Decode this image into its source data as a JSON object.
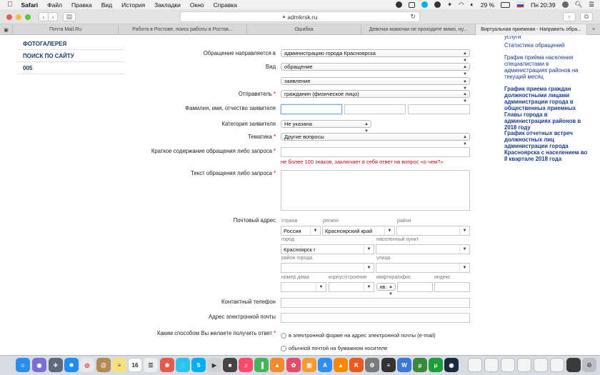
{
  "menubar": {
    "apple": "",
    "app": "Safari",
    "items": [
      "Файл",
      "Правка",
      "Вид",
      "История",
      "Закладки",
      "Окно",
      "Справка"
    ],
    "battery": "29 %",
    "clock": "Пн 20:39"
  },
  "toolbar": {
    "url": "admkrsk.ru",
    "back": "‹",
    "forward": "›"
  },
  "tabs": [
    "Почта Mail.Ru",
    "Работа в Ростове, поиск работы в Ростов...",
    "Ошибка",
    "Девочки мамочки не проходите мимо, ну...",
    "Виртуальная приемная - Направить обра..."
  ],
  "sidebar": {
    "items": [
      "ФОТОГАЛЕРЕЯ",
      "ПОИСК ПО САЙТУ",
      "005"
    ]
  },
  "form": {
    "direct_label": "Обращение направляется в",
    "direct_value": "администрацию города Красноярска",
    "type_label": "Вид",
    "type_value1": "обращение",
    "type_value2": "заявление",
    "sender_label": "Отправитель",
    "sender_value": "гражданин (физическое лицо)",
    "fio_label": "Фамилия, имя, отчество заявителя",
    "category_label": "Категория заявителя",
    "category_value": "Не указана",
    "topic_label": "Тематика",
    "topic_value": "Другие вопросы",
    "summary_label": "Краткое содержание обращения либо запроса",
    "summary_hint": "не более 100 знаков, заключает в себя ответ на вопрос «о чем?»",
    "text_label": "Текст обращения либо запроса",
    "postal_label": "Почтовый адрес",
    "country_label": "страна",
    "country_value": "Россия",
    "region_label": "регион",
    "region_value": "Красноярский край",
    "district_label": "район",
    "city_label": "город",
    "city_value": "Красноярск г",
    "settlement_label": "населенный пункт",
    "citydistrict_label": "район города",
    "street_label": "улица",
    "house_label": "номер дома",
    "building_label": "корпус/строение",
    "apt_label": "квартира/офис",
    "apt_type": "кв.",
    "zip_label": "индекс",
    "phone_label": "Контактный телефон",
    "email_label": "Адрес электронной почты",
    "reply_label": "Каким способом Вы желаете получить ответ",
    "reply_opt1": "в электронной форме на адрес электронной почты (e-mail)",
    "reply_opt2": "обычной почтой на бумажном носителе",
    "required_mark": "*"
  },
  "right_sidebar": {
    "cut": "услуги",
    "links": [
      "Статистика обращений",
      "График приёма населения специалистами в администрациях районов на текущий месяц",
      "График приема граждан должностными лицами администрации города в общественных приемных Главы города в администрациях районов в 2018 году",
      "График отчетных встреч должностных лиц администрации города Красноярска с населением во II квартале 2018 года"
    ]
  },
  "dock": {
    "calendar_day": "16"
  },
  "colors": {
    "link": "#1a3a8a",
    "required": "#d00000",
    "hint": "#d0021b"
  }
}
